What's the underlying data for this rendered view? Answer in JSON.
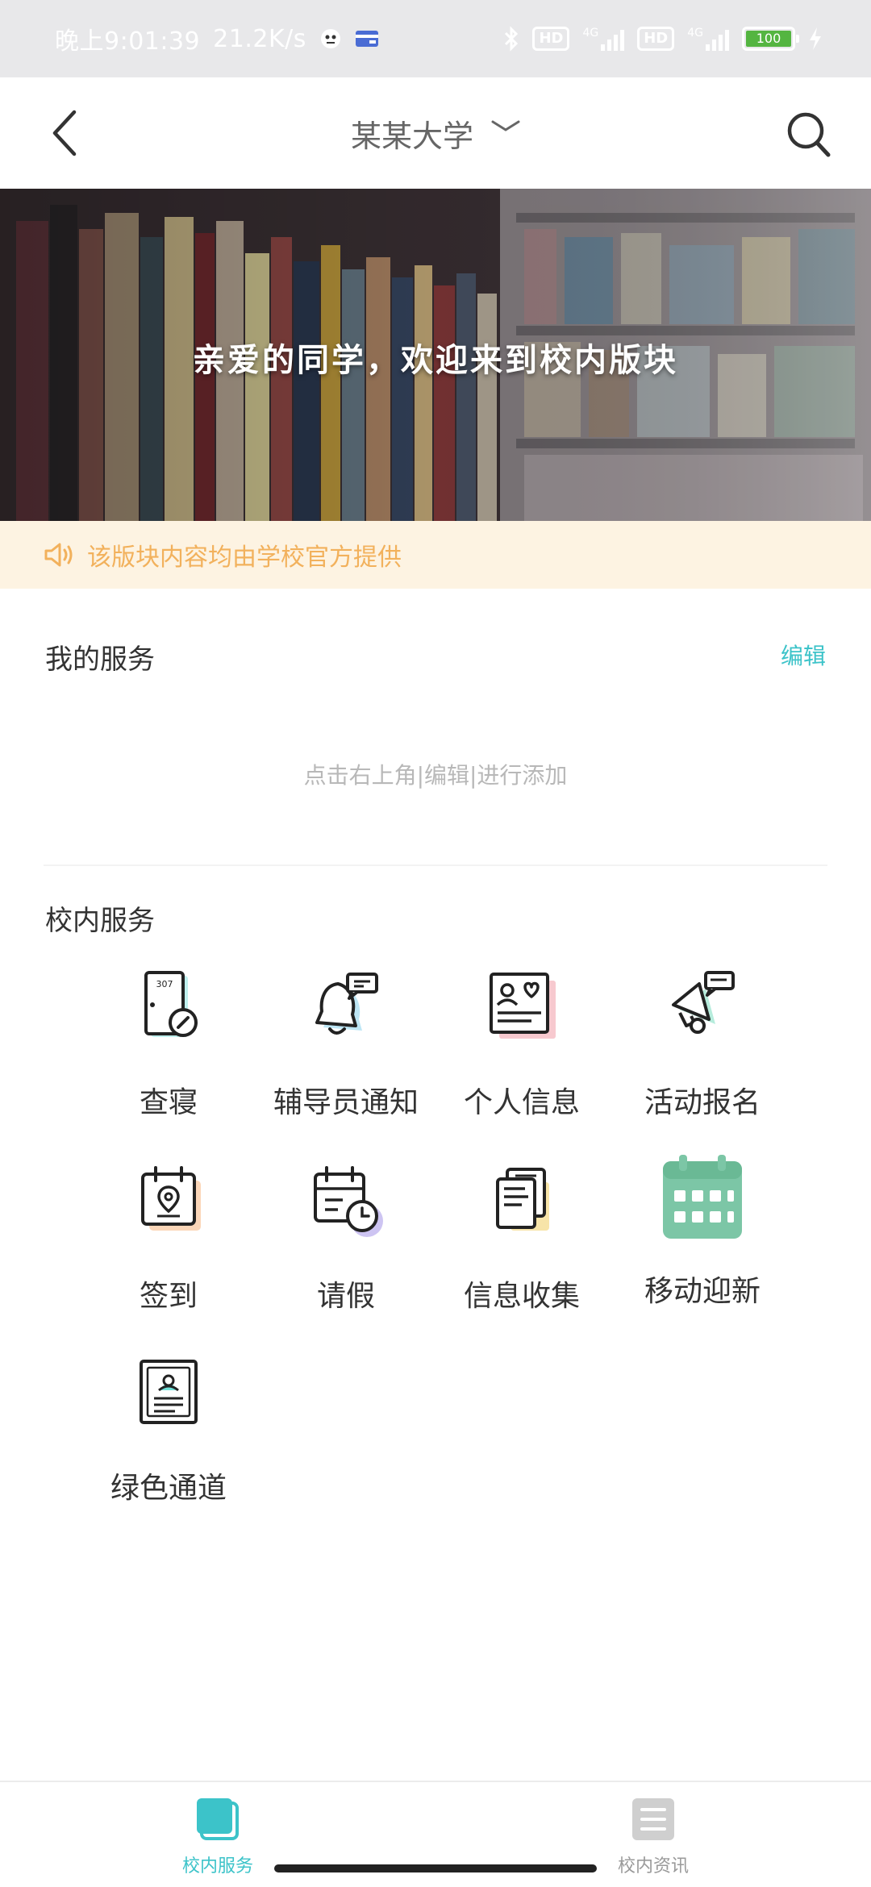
{
  "status_bar": {
    "time": "晚上9:01:39",
    "speed": "21.2K/s",
    "hd1": "HD",
    "hd2": "HD",
    "net1": "4G",
    "net2": "4G",
    "battery": "100"
  },
  "nav": {
    "title": "某某大学"
  },
  "banner": {
    "text": "亲爱的同学，欢迎来到校内版块"
  },
  "notice": {
    "text": "该版块内容均由学校官方提供"
  },
  "my_services": {
    "title": "我的服务",
    "edit_label": "编辑",
    "empty_hint": "点击右上角|编辑|进行添加"
  },
  "campus_services": {
    "title": "校内服务",
    "items": [
      {
        "label": "查寝",
        "icon": "dorm-check-icon",
        "door_number": "307"
      },
      {
        "label": "辅导员通知",
        "icon": "counselor-notice-icon"
      },
      {
        "label": "个人信息",
        "icon": "personal-info-icon"
      },
      {
        "label": "活动报名",
        "icon": "activity-signup-icon"
      },
      {
        "label": "签到",
        "icon": "check-in-icon"
      },
      {
        "label": "请假",
        "icon": "leave-request-icon"
      },
      {
        "label": "信息收集",
        "icon": "info-collection-icon"
      },
      {
        "label": "移动迎新",
        "icon": "mobile-welcome-icon"
      },
      {
        "label": "绿色通道",
        "icon": "green-channel-icon"
      }
    ]
  },
  "tab_bar": {
    "tabs": [
      {
        "label": "校内服务",
        "active": true
      },
      {
        "label": "校内资讯",
        "active": false
      }
    ]
  },
  "colors": {
    "accent": "#3cc3c9",
    "notice_bg": "#fdf3e2",
    "notice_text": "#f2b15c",
    "calendar_green": "#7cc6a6"
  }
}
